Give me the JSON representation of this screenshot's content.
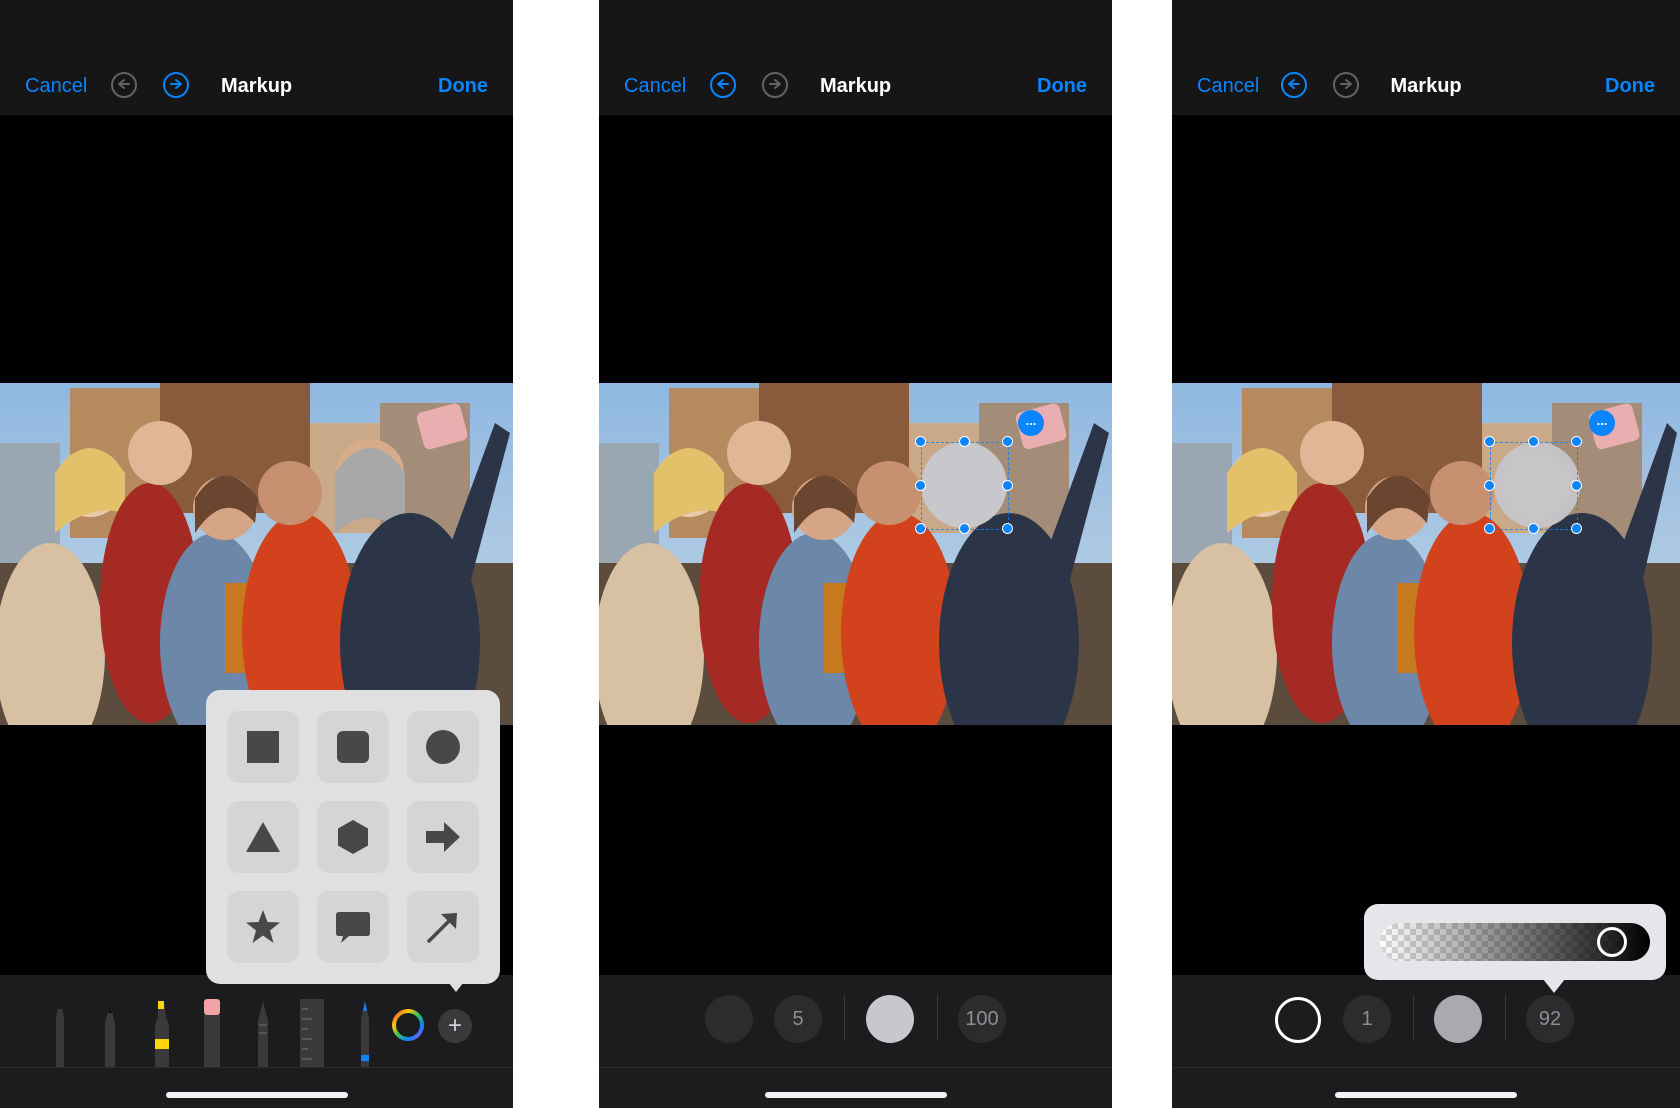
{
  "panels": [
    {
      "header": {
        "cancel": "Cancel",
        "title": "Markup",
        "done": "Done"
      },
      "shapes_menu": {
        "items": [
          "square",
          "rounded-square",
          "circle",
          "triangle",
          "hexagon",
          "arrow",
          "star",
          "speech-bubble",
          "line-arrow"
        ]
      },
      "toolbar": {
        "tools": [
          "pen",
          "marker",
          "highlighter",
          "eraser",
          "lasso",
          "ruler",
          "pencil"
        ],
        "plus_label": "+"
      }
    },
    {
      "header": {
        "cancel": "Cancel",
        "title": "Markup",
        "done": "Done"
      },
      "shape_toolbar": {
        "border_width": "5",
        "opacity": "100"
      },
      "selection_menu_label": "..."
    },
    {
      "header": {
        "cancel": "Cancel",
        "title": "Markup",
        "done": "Done"
      },
      "shape_toolbar": {
        "border_width": "1",
        "opacity": "92"
      },
      "selection_menu_label": "...",
      "opacity_slider": {
        "value": 0.92
      }
    }
  ],
  "colors": {
    "accent": "#0a84ff",
    "bar_bg": "#161616",
    "shape_fill": "#c7c7cc"
  }
}
